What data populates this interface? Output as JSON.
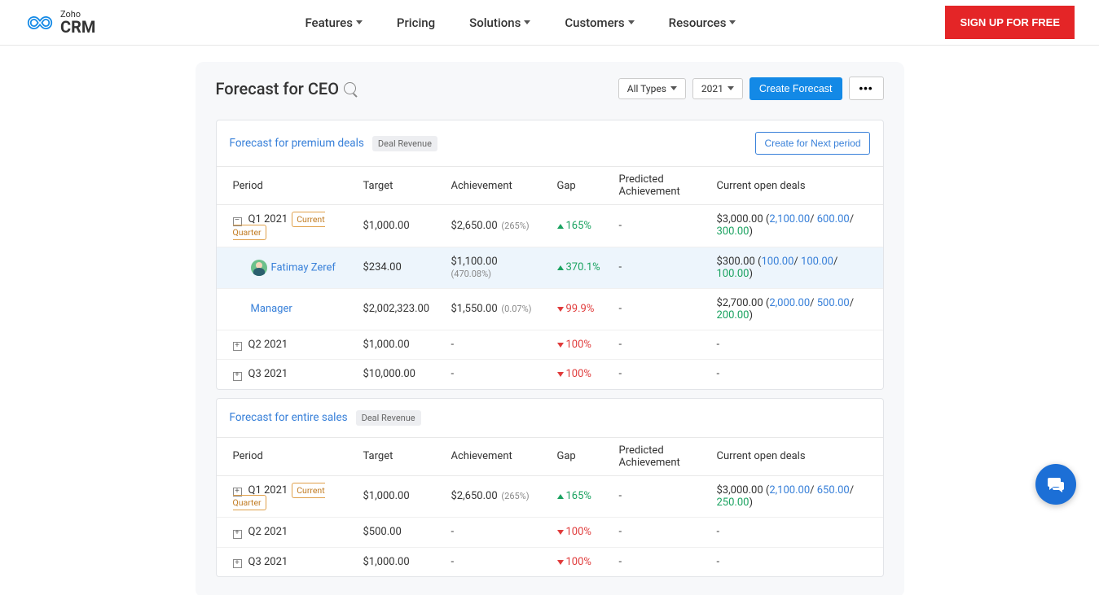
{
  "topnav": {
    "brand": "Zoho",
    "product": "CRM",
    "items": [
      "Features",
      "Pricing",
      "Solutions",
      "Customers",
      "Resources"
    ],
    "items_dropdown": [
      true,
      false,
      true,
      true,
      true
    ],
    "signup": "SIGN UP FOR FREE"
  },
  "page": {
    "title": "Forecast for CEO",
    "filters": {
      "types": "All Types",
      "year": "2021"
    },
    "create": "Create Forecast"
  },
  "headers": [
    "Period",
    "Target",
    "Achievement",
    "Gap",
    "Predicted Achievement",
    "Current open deals"
  ],
  "badge_deal_revenue": "Deal Revenue",
  "current_quarter_label": "Current Quarter",
  "create_next": "Create for Next period",
  "cards": [
    {
      "title": "Forecast for premium deals",
      "show_create_next": true,
      "rows": [
        {
          "toggle": "-",
          "period": "Q1 2021",
          "cq": true,
          "target": "$1,000.00",
          "ach": "$2,650.00",
          "ach_pct": "(265%)",
          "gap_dir": "up",
          "gap": "165%",
          "pred": "-",
          "open": {
            "total": "$3,000.00",
            "b": [
              "2,100.00",
              "600.00",
              "300.00"
            ]
          }
        },
        {
          "indent": true,
          "highlight": true,
          "avatar": true,
          "name": "Fatimay Zeref",
          "target": "$234.00",
          "ach": "$1,100.00",
          "ach_pct": "(470.08%)",
          "gap_dir": "up",
          "gap": "370.1%",
          "pred": "-",
          "open": {
            "total": "$300.00",
            "b": [
              "100.00",
              "100.00",
              "100.00"
            ]
          }
        },
        {
          "indent": true,
          "name": "Manager",
          "target": "$2,002,323.00",
          "ach": "$1,550.00",
          "ach_pct": "(0.07%)",
          "gap_dir": "down",
          "gap": "99.9%",
          "pred": "-",
          "open": {
            "total": "$2,700.00",
            "b": [
              "2,000.00",
              "500.00",
              "200.00"
            ]
          }
        },
        {
          "toggle": "+",
          "period": "Q2 2021",
          "target": "$1,000.00",
          "ach": "-",
          "gap_dir": "down",
          "gap": "100%",
          "pred": "-",
          "open_dash": "-"
        },
        {
          "toggle": "+",
          "period": "Q3 2021",
          "target": "$10,000.00",
          "ach": "-",
          "gap_dir": "down",
          "gap": "100%",
          "pred": "-",
          "open_dash": "-"
        }
      ]
    },
    {
      "title": "Forecast for entire sales",
      "show_create_next": false,
      "rows": [
        {
          "toggle": "+",
          "period": "Q1 2021",
          "cq": true,
          "target": "$1,000.00",
          "ach": "$2,650.00",
          "ach_pct": "(265%)",
          "gap_dir": "up",
          "gap": "165%",
          "pred": "-",
          "open": {
            "total": "$3,000.00",
            "b": [
              "2,100.00",
              "650.00",
              "250.00"
            ]
          }
        },
        {
          "toggle": "+",
          "period": "Q2 2021",
          "target": "$500.00",
          "ach": "-",
          "gap_dir": "down",
          "gap": "100%",
          "pred": "-",
          "open_dash": "-"
        },
        {
          "toggle": "+",
          "period": "Q3 2021",
          "target": "$1,000.00",
          "ach": "-",
          "gap_dir": "down",
          "gap": "100%",
          "pred": "-",
          "open_dash": "-"
        }
      ]
    }
  ]
}
